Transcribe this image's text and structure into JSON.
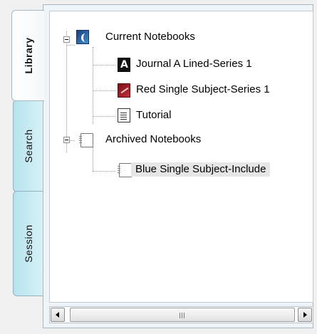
{
  "tabs": [
    {
      "label": "Library",
      "active": true
    },
    {
      "label": "Search",
      "active": false
    },
    {
      "label": "Session",
      "active": false
    }
  ],
  "tree": {
    "groups": [
      {
        "label": "Current Notebooks",
        "icon": "notebook-color-icon",
        "expanded": true,
        "items": [
          {
            "label": "Journal A Lined-Series 1",
            "icon": "journal-notebook-icon"
          },
          {
            "label": "Red Single Subject-Series 1",
            "icon": "red-notebook-icon"
          },
          {
            "label": "Tutorial",
            "icon": "document-icon"
          }
        ]
      },
      {
        "label": "Archived Notebooks",
        "icon": "spiral-notebook-icon",
        "expanded": true,
        "items": [
          {
            "label": "Blue Single Subject-Include",
            "icon": "spiral-notebook-icon",
            "selected": true
          }
        ]
      }
    ]
  },
  "scrollbar": {
    "orientation": "horizontal"
  }
}
